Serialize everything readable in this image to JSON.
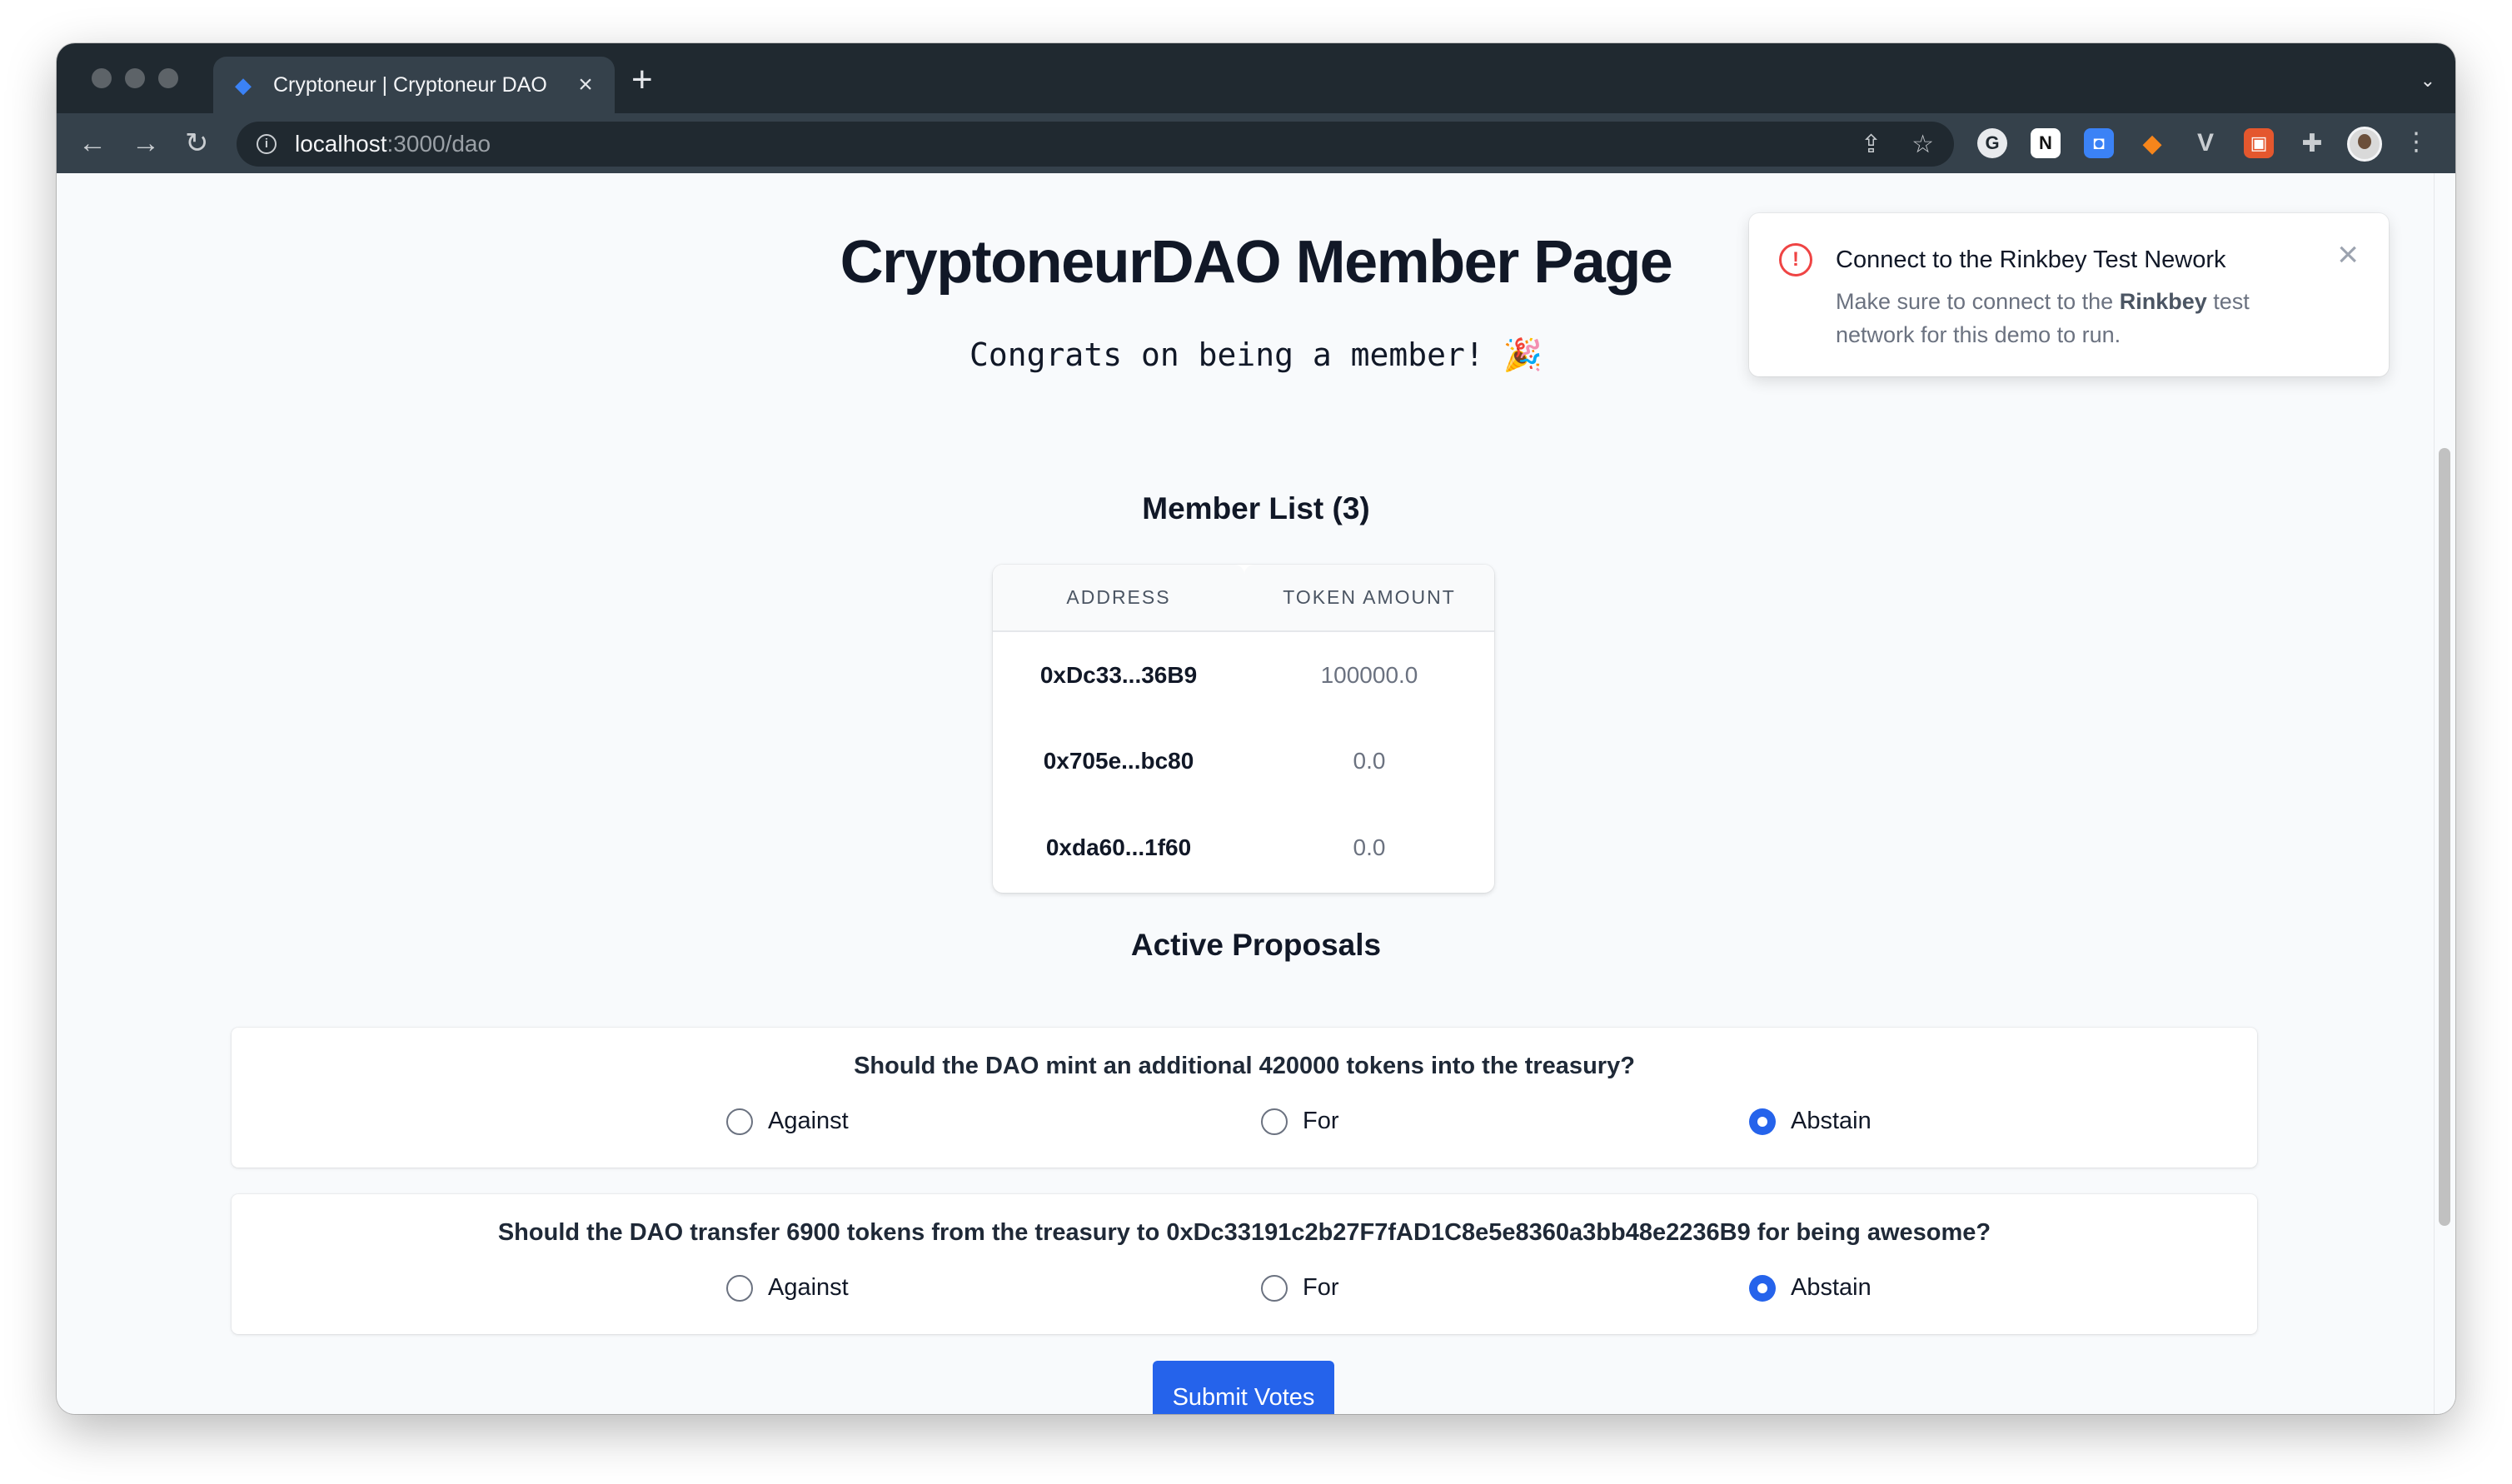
{
  "browser": {
    "tab_title": "Cryptoneur | Cryptoneur DAO",
    "url_host": "localhost",
    "url_rest": ":3000/dao"
  },
  "page": {
    "title": "CryptoneurDAO Member Page",
    "subtitle": "Congrats on being a member! 🎉"
  },
  "members": {
    "heading": "Member List (3)",
    "columns": [
      "ADDRESS",
      "TOKEN AMOUNT"
    ],
    "rows": [
      {
        "address": "0xDc33...36B9",
        "amount": "100000.0"
      },
      {
        "address": "0x705e...bc80",
        "amount": "0.0"
      },
      {
        "address": "0xda60...1f60",
        "amount": "0.0"
      }
    ]
  },
  "proposals": {
    "heading": "Active Proposals",
    "items": [
      {
        "question": "Should the DAO mint an additional 420000 tokens into the treasury?",
        "options": [
          "Against",
          "For",
          "Abstain"
        ],
        "selected": "Abstain"
      },
      {
        "question": "Should the DAO transfer 6900 tokens from the treasury to 0xDc33191c2b27F7fAD1C8e5e8360a3bb48e2236B9 for being awesome?",
        "options": [
          "Against",
          "For",
          "Abstain"
        ],
        "selected": "Abstain"
      }
    ],
    "submit_label": "Submit Votes"
  },
  "toast": {
    "title": "Connect to the Rinkbey Test Nework",
    "body_pre": "Make sure to connect to the ",
    "body_bold": "Rinkbey",
    "body_post": " test network for this demo to run."
  },
  "colors": {
    "accent": "#2563eb",
    "error": "#ef4444"
  }
}
